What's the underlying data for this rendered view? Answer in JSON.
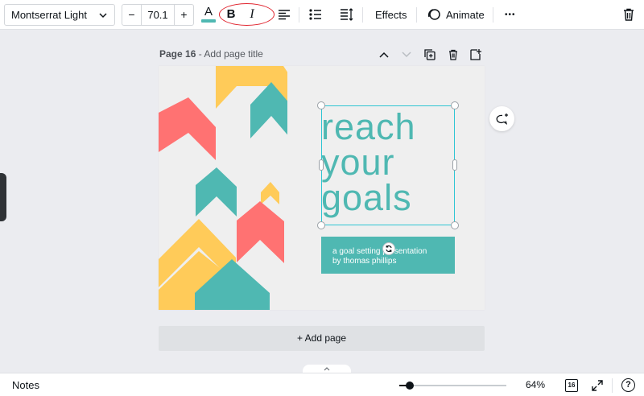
{
  "toolbar": {
    "font_name": "Montserrat Light",
    "size_minus": "−",
    "font_size": "70.1",
    "size_plus": "+",
    "color_letter": "A",
    "text_color": "#4fb8b2",
    "bold_label": "B",
    "italic_label": "I",
    "effects_label": "Effects",
    "animate_label": "Animate",
    "more_label": "•••"
  },
  "page": {
    "number_label": "Page 16",
    "separator": " - ",
    "title_placeholder": "Add page title"
  },
  "canvas": {
    "headline_lines": [
      "reach",
      "your",
      "goals"
    ],
    "subtitle_lines": [
      "a goal setting presentation",
      "by thomas phillips"
    ],
    "colors": {
      "coral": "#ff7272",
      "yellow": "#ffcb59",
      "teal": "#4fb8b2",
      "background": "#efefef"
    }
  },
  "add_page_label": "+ Add page",
  "bottom": {
    "notes_label": "Notes",
    "zoom_value": "64%",
    "zoom_fraction": 0.1,
    "page_count": "16",
    "help_label": "?"
  }
}
